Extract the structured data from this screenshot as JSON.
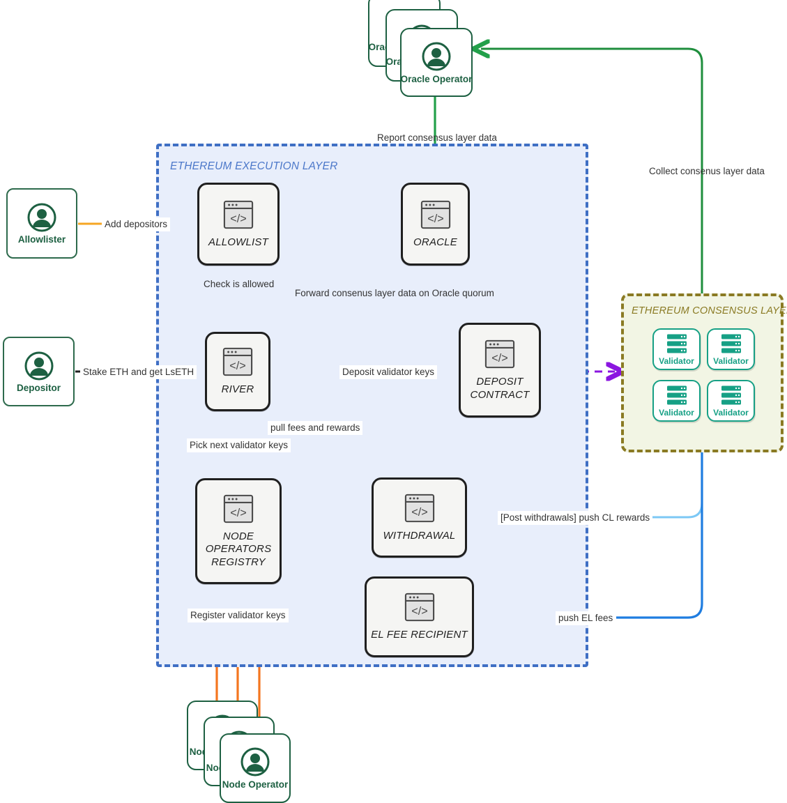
{
  "zones": {
    "execution": {
      "title": "ETHEREUM EXECUTION LAYER",
      "color": "#4b77c9",
      "fill": "#e8eefb"
    },
    "consensus": {
      "title": "ETHEREUM CONSENSUS LAYER",
      "color": "#8a7a23",
      "fill": "#f2f5e4"
    }
  },
  "contracts": {
    "allowlist": {
      "label": "ALLOWLIST",
      "icon": "code-window-icon"
    },
    "oracle": {
      "label": "ORACLE",
      "icon": "code-window-icon"
    },
    "river": {
      "label": "RIVER",
      "icon": "code-window-icon"
    },
    "deposit_contract": {
      "label": "DEPOSIT\nCONTRACT",
      "icon": "code-window-icon"
    },
    "node_operators_registry": {
      "label": "NODE\nOPERATORS\nREGISTRY",
      "icon": "code-window-icon"
    },
    "withdrawal": {
      "label": "WITHDRAWAL",
      "icon": "code-window-icon"
    },
    "el_fee_recipient": {
      "label": "EL FEE RECIPIENT",
      "icon": "code-window-icon"
    }
  },
  "actors": {
    "oracle_operator": {
      "label": "Oracle Operator",
      "icon": "user-icon",
      "stacked": true,
      "stack_count": 3
    },
    "node_operator": {
      "label": "Node Operator",
      "icon": "user-icon",
      "stacked": true,
      "stack_count": 3
    },
    "allowlister": {
      "label": "Allowlister",
      "icon": "user-icon"
    },
    "depositor": {
      "label": "Depositor",
      "icon": "user-icon"
    }
  },
  "validators": [
    {
      "label": "Validator",
      "icon": "server-icon"
    },
    {
      "label": "Validator",
      "icon": "server-icon"
    },
    {
      "label": "Validator",
      "icon": "server-icon"
    },
    {
      "label": "Validator",
      "icon": "server-icon"
    }
  ],
  "edges": {
    "report_consensus_layer_data": {
      "label": "Report consensus layer data",
      "color": "#22a04a"
    },
    "collect_consensus_layer_data": {
      "label": "Collect consenus layer data",
      "color": "#1f8e3d"
    },
    "add_depositors": {
      "label": "Add depositors",
      "color": "#f5a623"
    },
    "check_is_allowed": {
      "label": "Check is allowed",
      "color": "#1f1f1f"
    },
    "forward_consensus_layer_data": {
      "label": "Forward consenus layer data\non Oracle quorum",
      "color": "#1f8e3d"
    },
    "stake_eth": {
      "label": "Stake ETH and get LsETH",
      "color": "#1f1f1f"
    },
    "deposit_validator_keys": {
      "label": "Deposit validator keys",
      "color": "#8b16e0"
    },
    "pull_fees_and_rewards": {
      "label": "pull fees and rewards",
      "color": "#1f7de0"
    },
    "pick_next_validator_keys": {
      "label": "Pick next validator keys",
      "color": "#8b16e0"
    },
    "register_validator_keys": {
      "label": "Register validator keys",
      "color": "#f4761f"
    },
    "post_withdrawals_push_cl_rewards": {
      "label": "[Post withdrawals] push CL rewards",
      "color": "#7cc8f5"
    },
    "push_el_fees": {
      "label": "push EL fees",
      "color": "#1f7de0"
    }
  }
}
